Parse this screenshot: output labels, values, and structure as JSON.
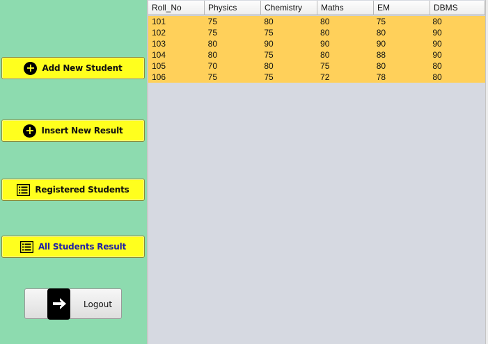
{
  "sidebar": {
    "buttons": [
      {
        "label": "Add New Student",
        "icon": "plus-circle-icon"
      },
      {
        "label": "Insert New Result",
        "icon": "plus-circle-icon"
      },
      {
        "label": "Registered Students",
        "icon": "list-icon"
      },
      {
        "label": "All Students Result",
        "icon": "list-icon",
        "active": true
      }
    ],
    "logout": {
      "label": "Logout",
      "icon": "logout-arrow-icon"
    }
  },
  "table": {
    "columns": [
      "Roll_No",
      "Physics",
      "Chemistry",
      "Maths",
      "EM",
      "DBMS"
    ],
    "rows": [
      [
        "101",
        "75",
        "80",
        "80",
        "75",
        "80"
      ],
      [
        "102",
        "75",
        "75",
        "80",
        "80",
        "90"
      ],
      [
        "103",
        "80",
        "90",
        "90",
        "90",
        "90"
      ],
      [
        "104",
        "80",
        "75",
        "80",
        "88",
        "90"
      ],
      [
        "105",
        "70",
        "80",
        "75",
        "80",
        "80"
      ],
      [
        "106",
        "75",
        "75",
        "72",
        "78",
        "80"
      ]
    ]
  },
  "colors": {
    "sidebar_bg": "#8ddbaf",
    "button_bg": "#ffff1e",
    "row_highlight": "#ffd05a",
    "table_bg": "#d6d9e1",
    "active_label": "#2020a8"
  }
}
